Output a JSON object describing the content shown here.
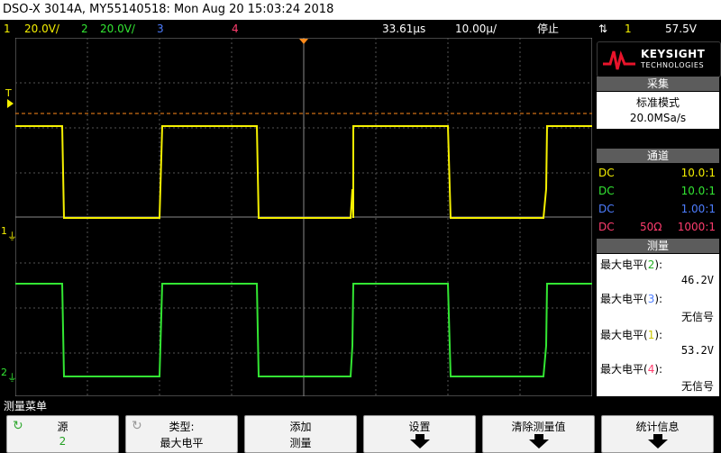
{
  "title": "DSO-X 3014A, MY55140518: Mon Aug 20 15:03:24 2018",
  "status": {
    "ch1_num": "1",
    "ch1_scale": "20.0V/",
    "ch2_num": "2",
    "ch2_scale": "20.0V/",
    "ch3_num": "3",
    "ch4_num": "4",
    "time_offset": "33.61µs",
    "time_scale": "10.00µ/",
    "run_state": "停止",
    "trigger_src": "1",
    "trigger_level": "57.5V"
  },
  "markers": {
    "trigger": "T",
    "ch1": "1",
    "ch2": "2"
  },
  "colors": {
    "ch1": "#f5f000",
    "ch2": "#33e633",
    "ch3": "#4d7dff",
    "ch4": "#ff3d6e",
    "trigger_line": "#ff8a1a",
    "grid": "#555555",
    "logo_red": "#e8142b"
  },
  "logo": {
    "brand": "KEYSIGHT",
    "sub": "TECHNOLOGIES"
  },
  "acquisition": {
    "header": "采集",
    "mode": "标准模式",
    "rate": "20.0MSa/s"
  },
  "channels": {
    "header": "通道",
    "rows": [
      {
        "coupling": "DC",
        "impedance": "",
        "probe": "10.0:1"
      },
      {
        "coupling": "DC",
        "impedance": "",
        "probe": "10.0:1"
      },
      {
        "coupling": "DC",
        "impedance": "",
        "probe": "1.00:1"
      },
      {
        "coupling": "DC",
        "impedance": "50Ω",
        "probe": "1000:1"
      }
    ]
  },
  "measurements": {
    "header": "测量",
    "items": [
      {
        "label": "最大电平",
        "ch": "2",
        "value": "46.2V"
      },
      {
        "label": "最大电平",
        "ch": "3",
        "value": "无信号"
      },
      {
        "label": "最大电平",
        "ch": "1",
        "value": "53.2V"
      },
      {
        "label": "最大电平",
        "ch": "4",
        "value": "无信号"
      }
    ]
  },
  "menu": {
    "title": "测量菜单",
    "softkeys": [
      {
        "line1": "源",
        "line2": "2",
        "icon": "rotate-knob-icon"
      },
      {
        "line1": "类型:",
        "line2": "最大电平",
        "icon": "rotate-knob-icon"
      },
      {
        "line1": "添加",
        "line2": "测量",
        "icon": ""
      },
      {
        "line1": "设置",
        "line2": "",
        "icon": "arrow-down-icon"
      },
      {
        "line1": "清除测量值",
        "line2": "",
        "icon": "arrow-down-icon"
      },
      {
        "line1": "统计信息",
        "line2": "",
        "icon": "arrow-down-icon"
      }
    ]
  }
}
